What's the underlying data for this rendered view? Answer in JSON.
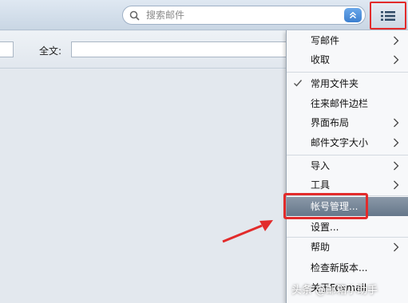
{
  "search": {
    "placeholder": "搜索邮件"
  },
  "filter": {
    "fulltext_label": "全文:"
  },
  "menu": {
    "items": [
      {
        "label": "写邮件",
        "submenu": true
      },
      {
        "label": "收取",
        "submenu": true
      },
      {
        "label": "常用文件夹",
        "checked": true
      },
      {
        "label": "往来邮件边栏"
      },
      {
        "label": "界面布局",
        "submenu": true
      },
      {
        "label": "邮件文字大小",
        "submenu": true
      },
      {
        "label": "导入",
        "submenu": true
      },
      {
        "label": "工具",
        "submenu": true
      },
      {
        "label": "帐号管理...",
        "highlighted": true
      },
      {
        "label": "设置..."
      },
      {
        "label": "帮助",
        "submenu": true
      },
      {
        "label": "检查新版本..."
      },
      {
        "label": "关于Foxmail"
      }
    ]
  },
  "watermark": "头条 @邮箱小助手",
  "colors": {
    "highlight_border": "#e22b2b",
    "annotation_arrow": "#e22b2b",
    "active_item": "#6f8093"
  }
}
